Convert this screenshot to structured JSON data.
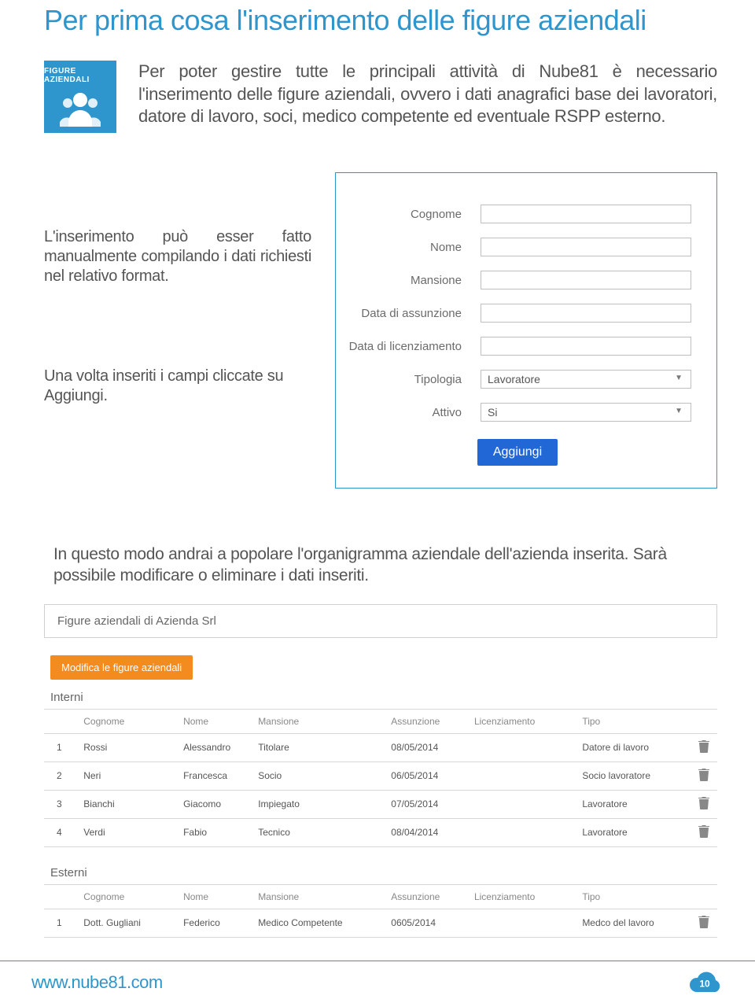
{
  "title": "Per prima cosa l'inserimento delle figure aziendali",
  "badge_title": "FIGURE AZIENDALI",
  "intro": "Per poter gestire tutte le principali attività di Nube81 è necessario l'inserimento delle figure aziendali, ovvero i dati anagrafici base dei lavoratori, datore di lavoro, soci, medico competente ed eventuale RSPP esterno.",
  "note1": "L'inserimento può esser fatto manualmente compilando i dati richiesti nel relativo format.",
  "note2": "Una volta inseriti i campi cliccate su Aggiungi.",
  "form": {
    "cognome_label": "Cognome",
    "nome_label": "Nome",
    "mansione_label": "Mansione",
    "assunzione_label": "Data di assunzione",
    "licenziamento_label": "Data di licenziamento",
    "tipologia_label": "Tipologia",
    "tipologia_value": "Lavoratore",
    "attivo_label": "Attivo",
    "attivo_value": "Si",
    "submit_label": "Aggiungi"
  },
  "mid_text": "In questo modo andrai a popolare l'organigramma aziendale dell'azienda inserita. Sarà possibile modificare o eliminare i dati inseriti.",
  "panel_title": "Figure aziendali di Azienda Srl",
  "modify_label": "Modifica le figure aziendali",
  "interni_title": "Interni",
  "esterni_title": "Esterni",
  "headers": {
    "cognome": "Cognome",
    "nome": "Nome",
    "mansione": "Mansione",
    "assunzione": "Assunzione",
    "licenziamento": "Licenziamento",
    "tipo": "Tipo"
  },
  "interni": [
    {
      "n": "1",
      "cognome": "Rossi",
      "nome": "Alessandro",
      "mansione": "Titolare",
      "assunzione": "08/05/2014",
      "licenziamento": "",
      "tipo": "Datore di lavoro"
    },
    {
      "n": "2",
      "cognome": "Neri",
      "nome": "Francesca",
      "mansione": "Socio",
      "assunzione": "06/05/2014",
      "licenziamento": "",
      "tipo": "Socio lavoratore"
    },
    {
      "n": "3",
      "cognome": "Bianchi",
      "nome": "Giacomo",
      "mansione": "Impiegato",
      "assunzione": "07/05/2014",
      "licenziamento": "",
      "tipo": "Lavoratore"
    },
    {
      "n": "4",
      "cognome": "Verdi",
      "nome": "Fabio",
      "mansione": "Tecnico",
      "assunzione": "08/04/2014",
      "licenziamento": "",
      "tipo": "Lavoratore"
    }
  ],
  "esterni": [
    {
      "n": "1",
      "cognome": "Dott. Gugliani",
      "nome": "Federico",
      "mansione": "Medico Competente",
      "assunzione": "0605/2014",
      "licenziamento": "",
      "tipo": "Medco del lavoro"
    }
  ],
  "footer_url": "www.nube81.com",
  "page_number": "10"
}
